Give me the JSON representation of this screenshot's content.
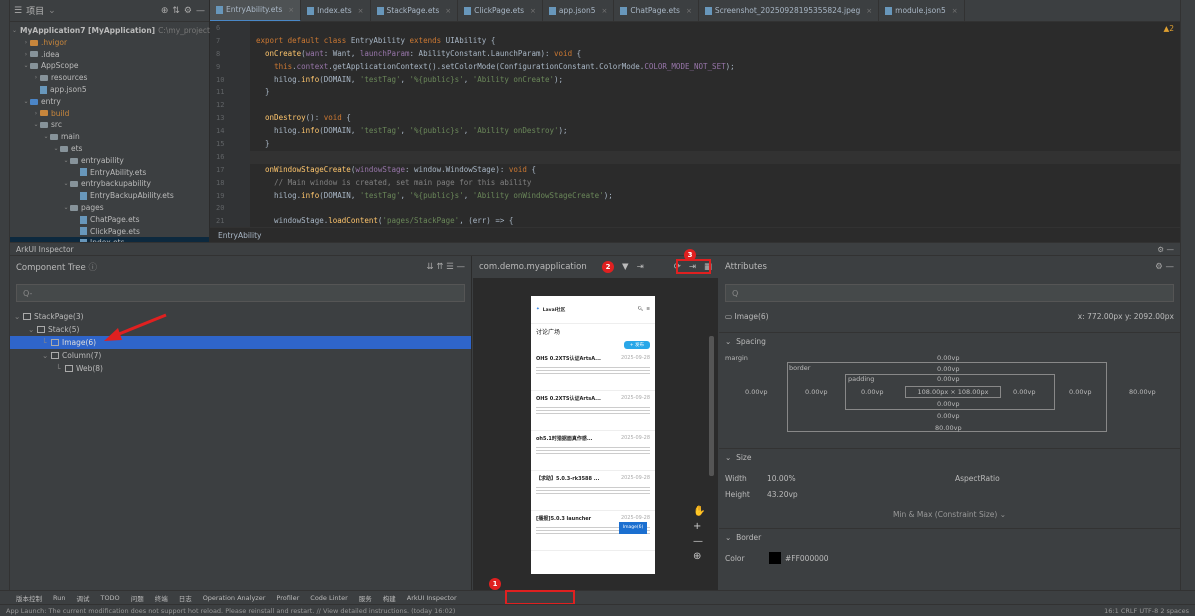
{
  "project": {
    "title": "项目",
    "root": "MyApplication7 [MyApplication]",
    "root_path": "C:\\my_project\\M",
    "items": [
      {
        "label": ".hvigor",
        "depth": 1,
        "kind": "folder-orange"
      },
      {
        "label": ".idea",
        "depth": 1,
        "kind": "folder"
      },
      {
        "label": "AppScope",
        "depth": 1,
        "kind": "folder"
      },
      {
        "label": "resources",
        "depth": 2,
        "kind": "folder"
      },
      {
        "label": "app.json5",
        "depth": 2,
        "kind": "file"
      },
      {
        "label": "entry",
        "depth": 1,
        "kind": "folder-blue"
      },
      {
        "label": "build",
        "depth": 2,
        "kind": "folder-orange"
      },
      {
        "label": "src",
        "depth": 2,
        "kind": "folder"
      },
      {
        "label": "main",
        "depth": 3,
        "kind": "folder"
      },
      {
        "label": "ets",
        "depth": 4,
        "kind": "folder"
      },
      {
        "label": "entryability",
        "depth": 5,
        "kind": "folder"
      },
      {
        "label": "EntryAbility.ets",
        "depth": 6,
        "kind": "file"
      },
      {
        "label": "entrybackupability",
        "depth": 5,
        "kind": "folder"
      },
      {
        "label": "EntryBackupAbility.ets",
        "depth": 6,
        "kind": "file"
      },
      {
        "label": "pages",
        "depth": 5,
        "kind": "folder"
      },
      {
        "label": "ChatPage.ets",
        "depth": 6,
        "kind": "file"
      },
      {
        "label": "ClickPage.ets",
        "depth": 6,
        "kind": "file"
      },
      {
        "label": "Index.ets",
        "depth": 6,
        "kind": "file"
      }
    ]
  },
  "tabs": [
    "EntryAbility.ets",
    "Index.ets",
    "StackPage.ets",
    "ClickPage.ets",
    "app.json5",
    "ChatPage.ets",
    "Screenshot_20250928195355824.jpeg",
    "module.json5"
  ],
  "editor": {
    "warn": "▲2",
    "line_numbers": [
      "6",
      "7",
      "8",
      "9",
      "10",
      "11",
      "12",
      "13",
      "14",
      "15",
      "16",
      "17",
      "18",
      "19",
      "20",
      "21"
    ],
    "breadcrumb": "EntryAbility"
  },
  "inspector": {
    "title": "ArkUI Inspector",
    "component_tree_label": "Component Tree",
    "search_placeholder": "Q-",
    "nodes": [
      {
        "label": "StackPage(3)",
        "depth": 0
      },
      {
        "label": "Stack(5)",
        "depth": 1
      },
      {
        "label": "Image(6)",
        "depth": 2
      },
      {
        "label": "Column(7)",
        "depth": 2
      },
      {
        "label": "Web(8)",
        "depth": 3
      }
    ],
    "app_selector": "com.demo.myapplication",
    "badge2": "2",
    "badge3": "3",
    "badge1": "1"
  },
  "phone": {
    "site": "Laval社区",
    "heading": "讨论广场",
    "btn": "+ 发布",
    "posts": [
      {
        "title": "OHS 0.2XTS认证ArtsA...",
        "date": "2025-09-28"
      },
      {
        "title": "OHS 0.2XTS认证ArtsA...",
        "date": "2025-09-28"
      },
      {
        "title": "oh5.1时猎据面真作感...",
        "date": "2025-09-28"
      },
      {
        "title": "【求助】5.0.3-rk3588 ...",
        "date": "2025-09-28"
      },
      {
        "title": "[播报]5.0.3 launcher",
        "date": "2025-09-28"
      }
    ],
    "tooltip": "Image(6)"
  },
  "attributes": {
    "title": "Attributes",
    "node": "Image(6)",
    "coords": "x: 772.00px  y: 2092.00px",
    "spacing": "Spacing",
    "margin": "margin",
    "border": "border",
    "padding": "padding",
    "center": "108.00px × 108.00px",
    "z0": "0.00vp",
    "right": "80.00vp",
    "bottom": "80.00vp",
    "size": "Size",
    "width_k": "Width",
    "width_v": "10.00%",
    "height_k": "Height",
    "height_v": "43.20vp",
    "aspect": "AspectRatio",
    "minmax": "Min & Max (Constraint Size)",
    "border_sec": "Border",
    "color_k": "Color",
    "color_v": "#FF000000"
  },
  "toolstrip": [
    "版本控制",
    "Run",
    "调试",
    "TODO",
    "问题",
    "终端",
    "日志",
    "Operation Analyzer",
    "Profiler",
    "Code Linter",
    "服务",
    "构建",
    "ArkUI Inspector"
  ],
  "status": {
    "message": "App Launch: The current modification does not support hot reload. Please reinstall and restart. // View detailed instructions. (today 16:02)",
    "right": "16:1   CRLF   UTF-8   2 spaces"
  }
}
